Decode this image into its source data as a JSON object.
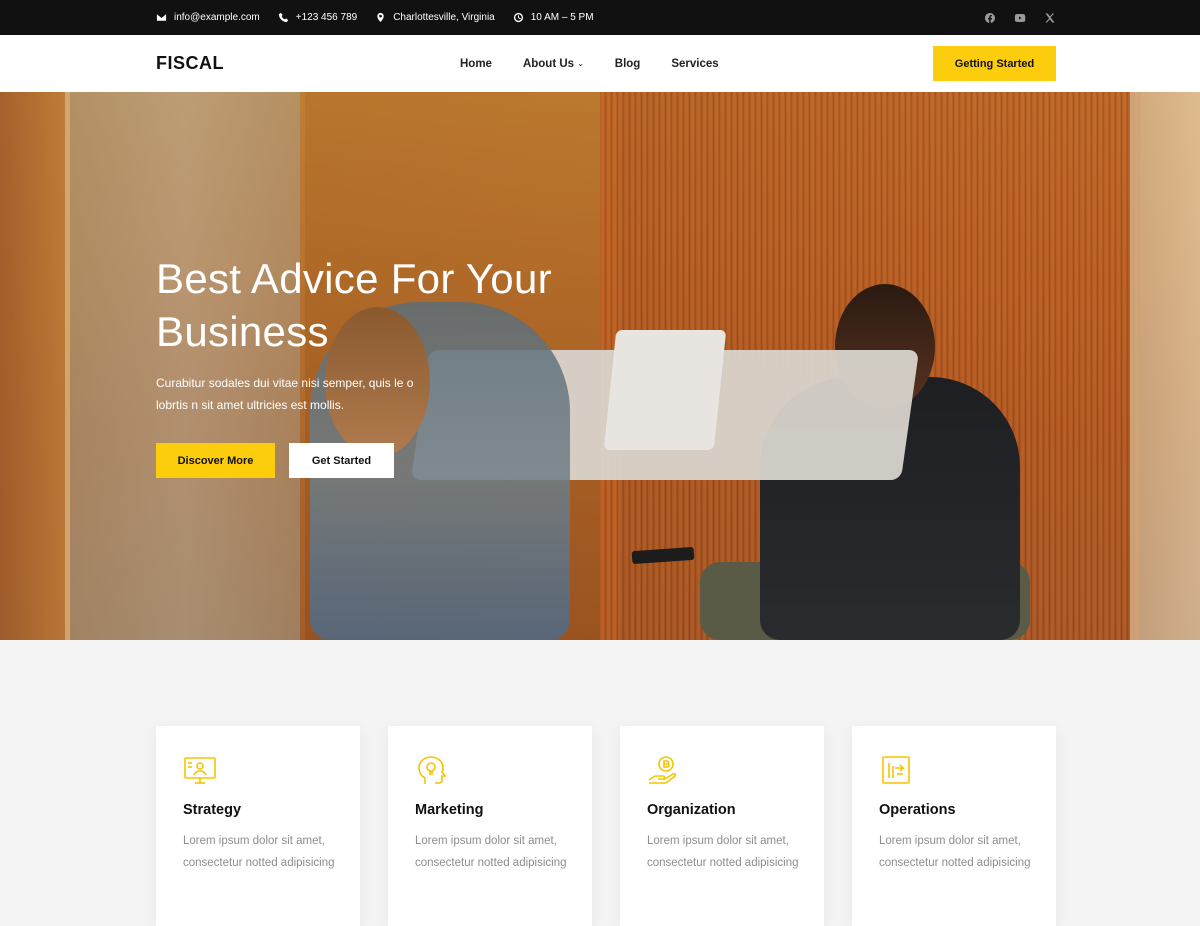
{
  "topbar": {
    "email": "info@example.com",
    "phone": "+123 456 789",
    "location": "Charlottesville, Virginia",
    "hours": "10 AM – 5 PM",
    "social": [
      "facebook-icon",
      "youtube-icon",
      "x-icon"
    ]
  },
  "header": {
    "logo": "FISCAL",
    "nav": [
      {
        "label": "Home"
      },
      {
        "label": "About Us",
        "dropdown": true
      },
      {
        "label": "Blog"
      },
      {
        "label": "Services"
      }
    ],
    "cta": "Getting Started"
  },
  "hero": {
    "title": "Best Advice For Your Business",
    "description": "Curabitur sodales dui vitae nisi semper, quis le o lobrtis n sit amet ultricies est mollis.",
    "primary_button": "Discover More",
    "secondary_button": "Get Started"
  },
  "features": [
    {
      "icon": "monitor-user-icon",
      "title": "Strategy",
      "text": "Lorem ipsum dolor sit amet, consectetur notted adipisicing"
    },
    {
      "icon": "head-bulb-icon",
      "title": "Marketing",
      "text": "Lorem ipsum dolor sit amet, consectetur notted adipisicing"
    },
    {
      "icon": "hand-coin-icon",
      "title": "Organization",
      "text": "Lorem ipsum dolor sit amet, consectetur notted adipisicing"
    },
    {
      "icon": "board-chart-icon",
      "title": "Operations",
      "text": "Lorem ipsum dolor sit amet, consectetur notted adipisicing"
    }
  ],
  "colors": {
    "accent": "#fccd0c",
    "topbar_bg": "#111111"
  }
}
